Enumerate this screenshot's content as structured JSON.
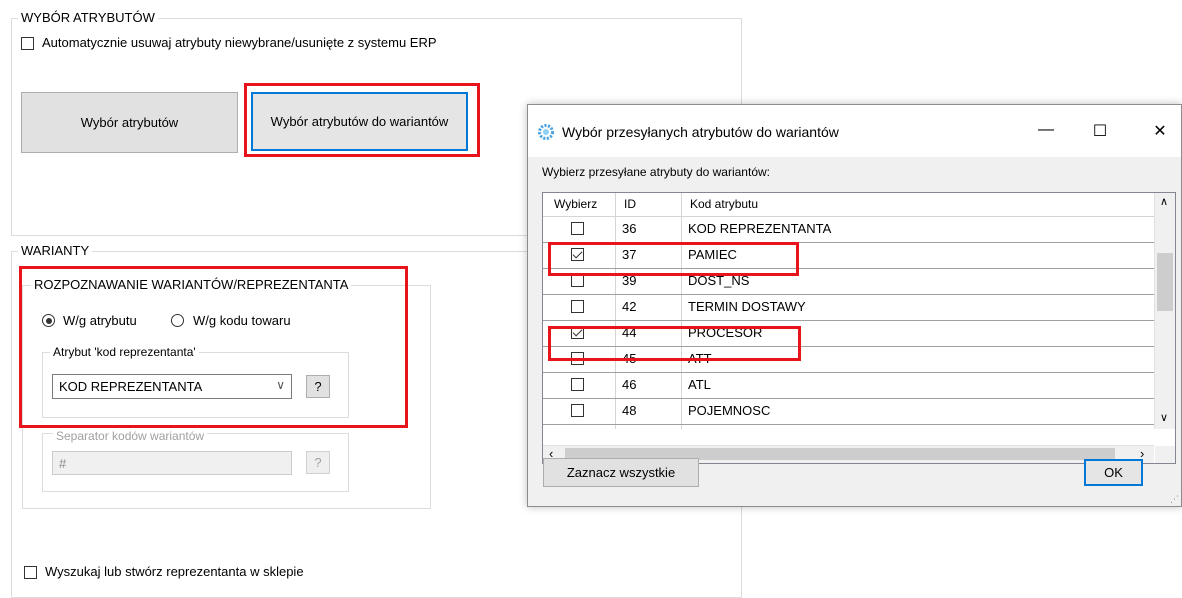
{
  "section_attrs": {
    "title": "WYBÓR ATRYBUTÓW",
    "auto_remove_label": "Automatycznie usuwaj atrybuty niewybrane/usunięte z systemu ERP",
    "btn_select_attrs": "Wybór atrybutów",
    "btn_select_variant_attrs": "Wybór atrybutów do wariantów"
  },
  "section_variants": {
    "title": "WARIANTY",
    "recognition_title": "ROZPOZNAWANIE WARIANTÓW/REPREZENTANTA",
    "radio_by_attr": "W/g atrybutu",
    "radio_by_code": "W/g kodu towaru",
    "attr_group_title": "Atrybut 'kod reprezentanta'",
    "attr_select_value": "KOD REPREZENTANTA",
    "help_btn": "?",
    "separator_group_title": "Separator kodów wariantów",
    "separator_value": "#",
    "search_rep_label": "Wyszukaj lub stwórz reprezentanta w sklepie"
  },
  "dialog": {
    "title": "Wybór przesyłanych atrybutów do wariantów",
    "minimize": "—",
    "maximize": "☐",
    "close": "✕",
    "instruction": "Wybierz przesyłane atrybuty do wariantów:",
    "columns": [
      "Wybierz",
      "ID",
      "Kod atrybutu"
    ],
    "rows": [
      {
        "checked": false,
        "id": "36",
        "code": "KOD REPREZENTANTA"
      },
      {
        "checked": true,
        "id": "37",
        "code": "PAMIEC"
      },
      {
        "checked": false,
        "id": "39",
        "code": "DOST_NS"
      },
      {
        "checked": false,
        "id": "42",
        "code": "TERMIN DOSTAWY"
      },
      {
        "checked": true,
        "id": "44",
        "code": "PROCESOR"
      },
      {
        "checked": false,
        "id": "45",
        "code": "ATT"
      },
      {
        "checked": false,
        "id": "46",
        "code": "ATL"
      },
      {
        "checked": false,
        "id": "48",
        "code": "POJEMNOSC"
      }
    ],
    "select_all_btn": "Zaznacz wszystkie",
    "ok_btn": "OK"
  },
  "colors": {
    "highlight_red": "#e8141b",
    "focus_blue": "#0078d7"
  }
}
